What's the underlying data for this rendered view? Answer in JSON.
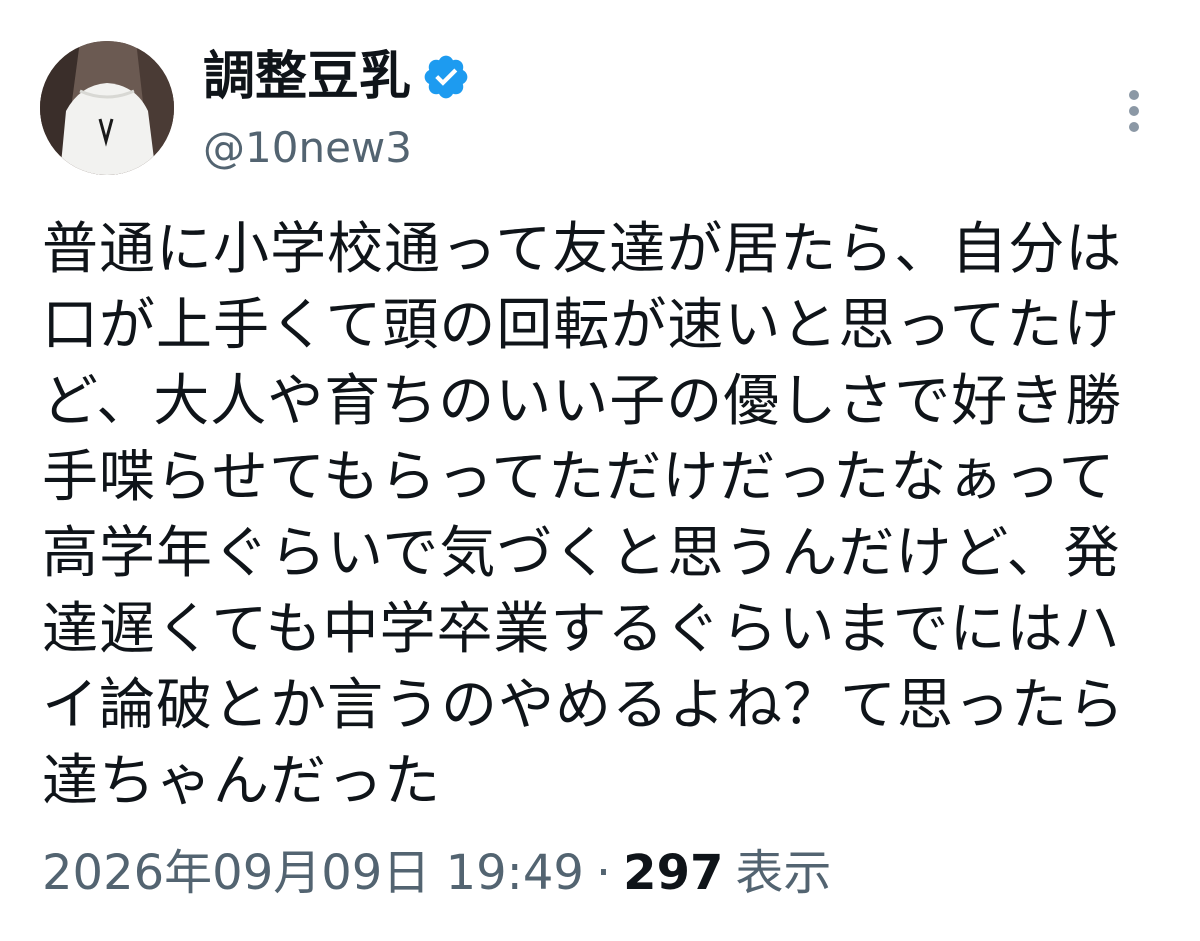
{
  "author": {
    "display_name": "調整豆乳",
    "handle": "@10new3",
    "verified_icon": "verified-badge-icon",
    "badge_color": "#1d9bf0"
  },
  "tweet": {
    "lines": [
      "普通に小学校通って友達が居たら、自分は",
      "口が上手くて頭の回転が速いと思ってたけ",
      "ど、大人や育ちのいい子の優しさで好き勝",
      "手喋らせてもらってただけだったなぁって",
      "高学年ぐらいで気づくと思うんだけど、発",
      "達遅くても中学卒業するぐらいまでにはハ",
      "イ論破とか言うのやめるよね？て思ったら",
      "達ちゃんだった"
    ]
  },
  "meta": {
    "timestamp": "2026年09月09日 19:49",
    "separator": "·",
    "views_count": "297",
    "views_label": "表示"
  },
  "icons": {
    "more": "more-options-icon",
    "avatar": "avatar"
  }
}
